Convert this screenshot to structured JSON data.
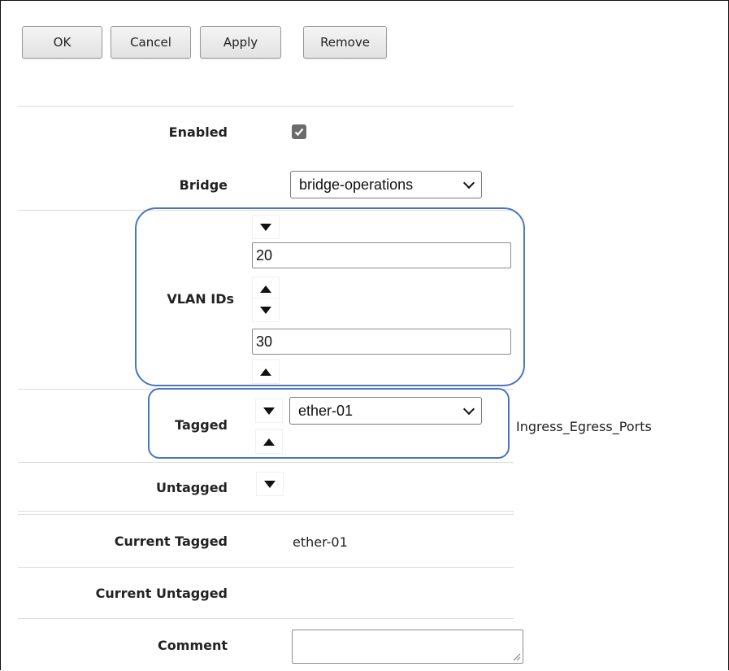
{
  "toolbar": {
    "ok_label": "OK",
    "cancel_label": "Cancel",
    "apply_label": "Apply",
    "remove_label": "Remove"
  },
  "form": {
    "enabled": {
      "label": "Enabled",
      "checked": true
    },
    "bridge": {
      "label": "Bridge",
      "value": "bridge-operations"
    },
    "vlan_ids": {
      "label": "VLAN IDs",
      "values": [
        "20",
        "30"
      ]
    },
    "tagged": {
      "label": "Tagged",
      "value": "ether-01",
      "hint": "Ingress_Egress_Ports"
    },
    "untagged": {
      "label": "Untagged"
    },
    "current_tagged": {
      "label": "Current Tagged",
      "value": "ether-01"
    },
    "current_untagged": {
      "label": "Current Untagged",
      "value": ""
    },
    "comment": {
      "label": "Comment",
      "value": ""
    }
  },
  "colors": {
    "highlight": "#4a74c4",
    "checkbox": "#6b6b6b"
  }
}
